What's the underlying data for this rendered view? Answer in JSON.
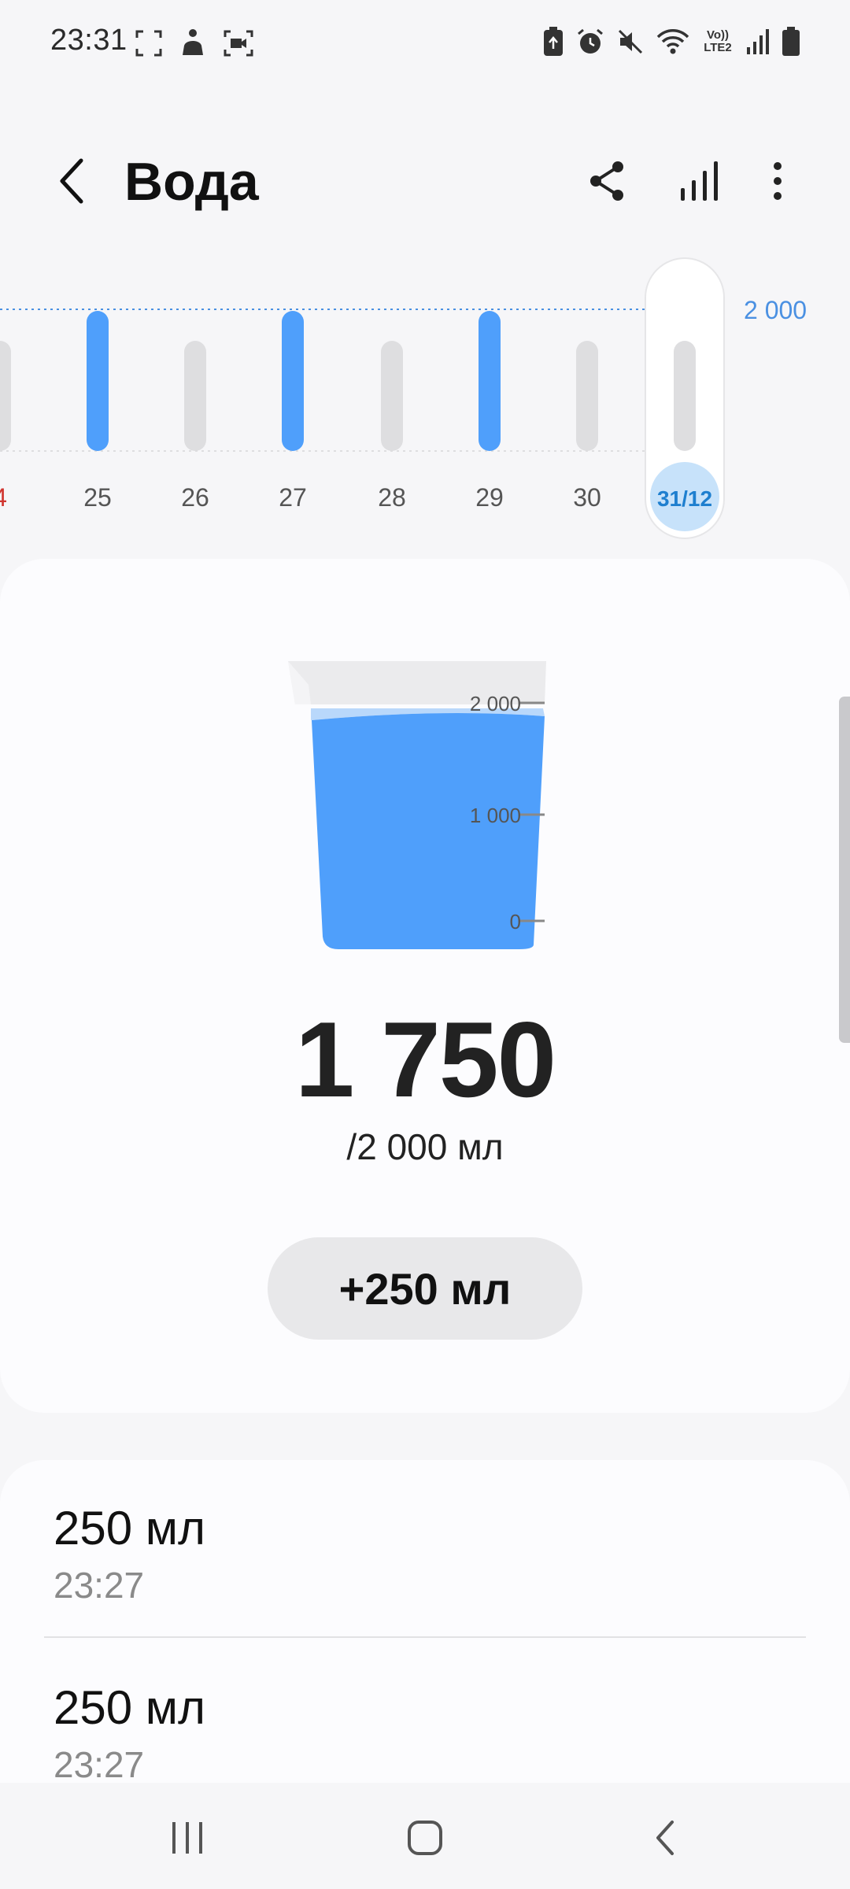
{
  "status_bar": {
    "time": "23:31",
    "left_icons": [
      "screenshot-frame-icon",
      "accessibility-person-icon",
      "screen-record-icon"
    ],
    "right_icons": [
      "battery-saver-icon",
      "alarm-icon",
      "mute-icon",
      "wifi-icon",
      "volte-lte2-icon",
      "signal-icon",
      "battery-icon"
    ],
    "network_label": "Vo)) LTE2"
  },
  "app_bar": {
    "title": "Вода",
    "actions": [
      "share-icon",
      "bar-chart-icon",
      "more-vert-icon"
    ]
  },
  "week_chart": {
    "goal_label": "2 000",
    "days": [
      {
        "label": "4",
        "achieved": false,
        "weekend": true
      },
      {
        "label": "25",
        "achieved": true,
        "weekend": false
      },
      {
        "label": "26",
        "achieved": false,
        "weekend": false
      },
      {
        "label": "27",
        "achieved": true,
        "weekend": false
      },
      {
        "label": "28",
        "achieved": false,
        "weekend": false
      },
      {
        "label": "29",
        "achieved": true,
        "weekend": false
      },
      {
        "label": "30",
        "achieved": false,
        "weekend": false
      },
      {
        "label": "31/12",
        "achieved": false,
        "weekend": false,
        "selected": true
      }
    ],
    "colors": {
      "achieved": "#4f9ffb",
      "not_achieved": "#dedee0",
      "goal_line": "#4a90e2",
      "weekend": "#d0352f",
      "selected_bg": "#c7e2fa",
      "selected_text": "#1e7fcf"
    }
  },
  "cup": {
    "scale_labels": [
      "2 000",
      "1 000",
      "0"
    ],
    "fill_fraction": 0.875,
    "water_color": "#4f9ffb"
  },
  "summary": {
    "amount": "1 750",
    "goal": "/2 000 мл",
    "add_button": "+250 мл"
  },
  "log": [
    {
      "amount": "250 мл",
      "time": "23:27"
    },
    {
      "amount": "250 мл",
      "time": "23:27"
    }
  ],
  "nav_bar": {
    "buttons": [
      "recents-icon",
      "home-icon",
      "back-icon"
    ]
  }
}
